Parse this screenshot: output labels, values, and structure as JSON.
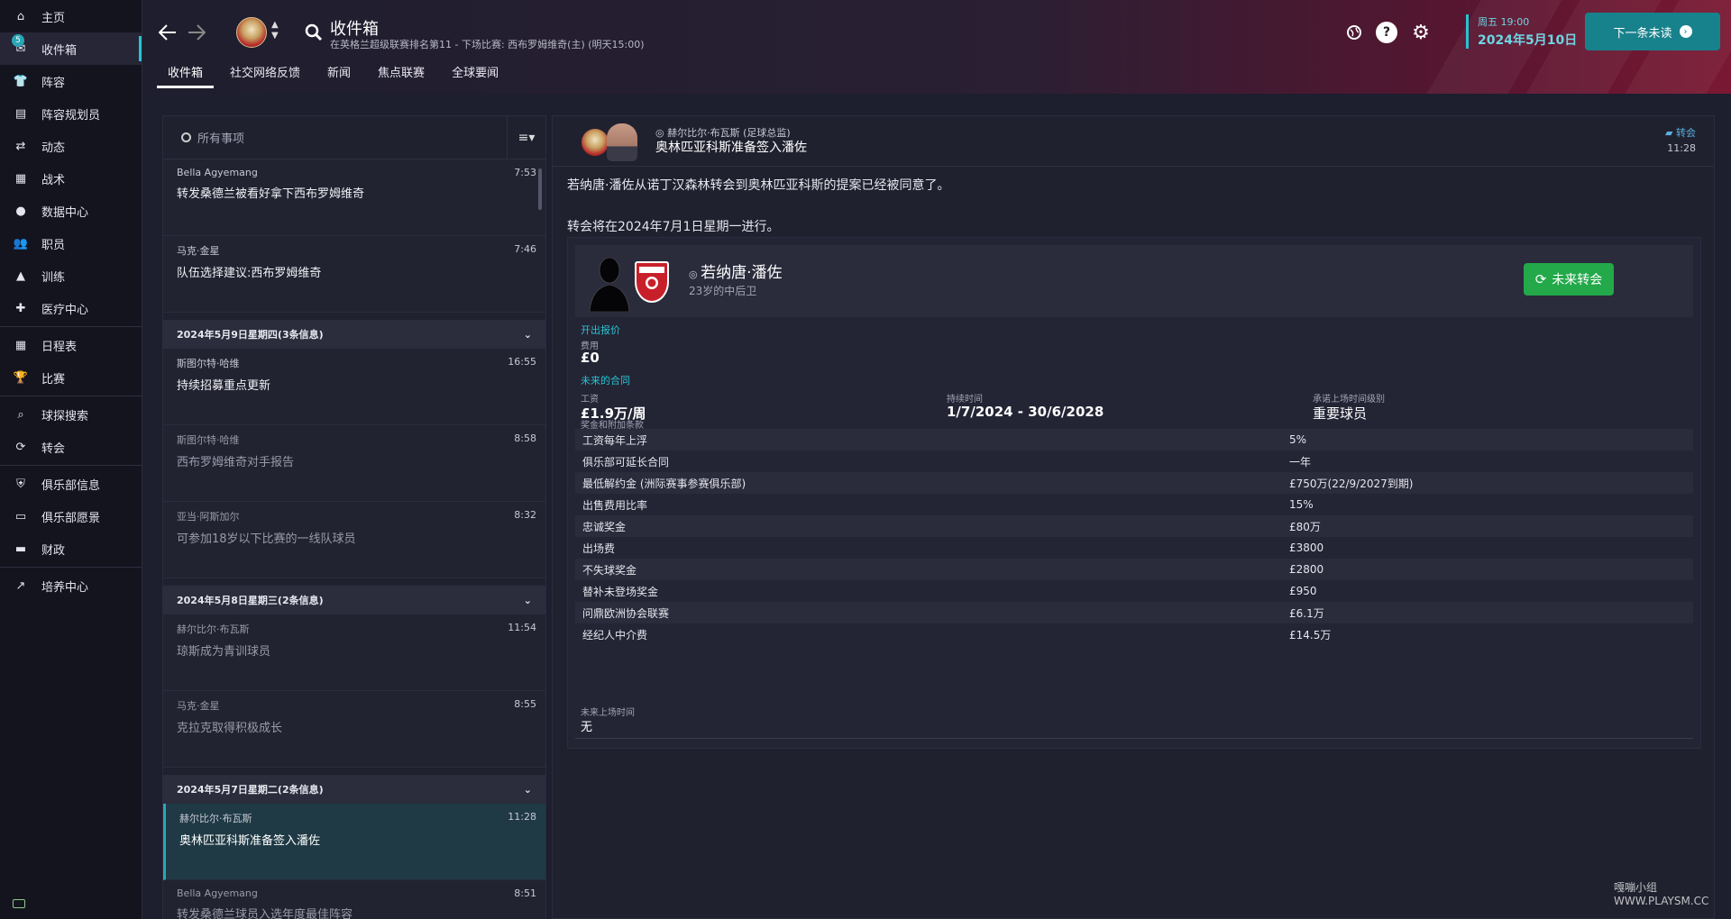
{
  "sidebar": {
    "inbox_badge": "5",
    "items": [
      {
        "label": "主页",
        "icon": "home-icon"
      },
      {
        "label": "收件箱",
        "icon": "inbox-icon"
      },
      {
        "label": "阵容",
        "icon": "squad-icon"
      },
      {
        "label": "阵容规划员",
        "icon": "clipboard-icon"
      },
      {
        "label": "动态",
        "icon": "dynamics-icon"
      },
      {
        "label": "战术",
        "icon": "tactics-icon"
      },
      {
        "label": "数据中心",
        "icon": "data-icon"
      },
      {
        "label": "职员",
        "icon": "staff-icon"
      },
      {
        "label": "训练",
        "icon": "training-icon"
      },
      {
        "label": "医疗中心",
        "icon": "medical-icon"
      },
      {
        "label": "日程表",
        "icon": "calendar-icon"
      },
      {
        "label": "比赛",
        "icon": "trophy-icon"
      },
      {
        "label": "球探搜索",
        "icon": "search-icon"
      },
      {
        "label": "转会",
        "icon": "transfer-icon"
      },
      {
        "label": "俱乐部信息",
        "icon": "shield-icon"
      },
      {
        "label": "俱乐部愿景",
        "icon": "briefcase-icon"
      },
      {
        "label": "财政",
        "icon": "money-icon"
      },
      {
        "label": "培养中心",
        "icon": "growth-icon"
      }
    ]
  },
  "header": {
    "title": "收件箱",
    "subtitle": "在英格兰超级联赛排名第11 - 下场比赛: 西布罗姆维奇(主) (明天15:00)",
    "tabs": [
      "收件箱",
      "社交网络反馈",
      "新闻",
      "焦点联赛",
      "全球要闻"
    ],
    "day": "周五 19:00",
    "date": "2024年5月10日",
    "next_label": "下一条未读",
    "accent": "#26c4d4"
  },
  "list": {
    "search_placeholder": "所有事项",
    "filter_icon": "≡▾",
    "messages_top": [
      {
        "sender": "Bella Agyemang",
        "time": "7:53",
        "subject": "转发桑德兰被看好拿下西布罗姆维奇"
      },
      {
        "sender": "马克·金星",
        "time": "7:46",
        "subject": "队伍选择建议:西布罗姆维奇"
      }
    ],
    "group1": "2024年5月9日星期四(3条信息)",
    "messages_g1": [
      {
        "sender": "斯图尔特·哈维",
        "time": "16:55",
        "subject": "持续招募重点更新"
      },
      {
        "sender": "斯图尔特·哈维",
        "time": "8:58",
        "subject": "西布罗姆维奇对手报告"
      },
      {
        "sender": "亚当·阿斯加尔",
        "time": "8:32",
        "subject": "可参加18岁以下比赛的一线队球员"
      }
    ],
    "group2": "2024年5月8日星期三(2条信息)",
    "messages_g2": [
      {
        "sender": "赫尔比尔·布瓦斯",
        "time": "11:54",
        "subject": "琼斯成为青训球员"
      },
      {
        "sender": "马克·金星",
        "time": "8:55",
        "subject": "克拉克取得积极成长"
      }
    ],
    "group3": "2024年5月7日星期二(2条信息)",
    "messages_g3": [
      {
        "sender": "赫尔比尔·布瓦斯",
        "time": "11:28",
        "subject": "奥林匹亚科斯准备签入潘佐"
      },
      {
        "sender": "Bella Agyemang",
        "time": "8:51",
        "subject": "转发桑德兰球员入选年度最佳阵容"
      }
    ]
  },
  "detail": {
    "from": "赫尔比尔·布瓦斯 (足球总监)",
    "subject": "奥林匹亚科斯准备签入潘佐",
    "tag": "转会",
    "time": "11:28",
    "line1": "若纳唐·潘佐从诺丁汉森林转会到奥林匹亚科斯的提案已经被同意了。",
    "line2": "转会将在2024年7月1日星期一进行。",
    "player_name": "若纳唐·潘佐",
    "player_desc": "23岁的中后卫",
    "future_btn": "未来转会",
    "offer_title": "开出报价",
    "fee_label": "费用",
    "fee_value": "£0",
    "contract_title": "未来的合同",
    "wage_label": "工资",
    "wage_value": "£1.9万/周",
    "duration_label": "持续时间",
    "duration_value": "1/7/2024 - 30/6/2028",
    "status_label": "承诺上场时间级别",
    "status_value": "重要球员",
    "bonus_label": "奖金和附加条款",
    "clauses": [
      {
        "k": "工资每年上浮",
        "v": "5%"
      },
      {
        "k": "俱乐部可延长合同",
        "v": "一年"
      },
      {
        "k": "最低解约金 (洲际赛事参赛俱乐部)",
        "v": "£750万(22/9/2027到期)"
      },
      {
        "k": "出售费用比率",
        "v": "15%"
      },
      {
        "k": "忠诚奖金",
        "v": "£80万"
      },
      {
        "k": "出场费",
        "v": "£3800"
      },
      {
        "k": "不失球奖金",
        "v": "£2800"
      },
      {
        "k": "替补未登场奖金",
        "v": "£950"
      },
      {
        "k": "问鼎欧洲协会联赛",
        "v": "£6.1万"
      },
      {
        "k": "经纪人中介费",
        "v": "£14.5万"
      }
    ],
    "future_time_label": "未来上场时间",
    "future_time_value": "无"
  },
  "watermark": "嘎嘣小组 WWW.PLAYSM.CC"
}
